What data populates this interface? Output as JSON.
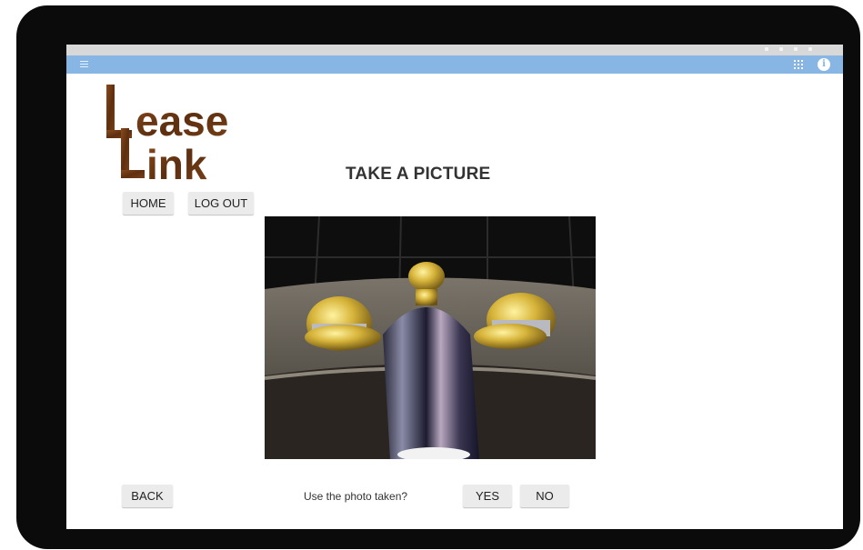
{
  "colors": {
    "app_bar": "#87b6e4",
    "device_frame": "#0b0b0b",
    "logo_brown": "#6e3a16"
  },
  "app_bar": {
    "menu_icon": "hamburger-icon",
    "grid_icon": "apps-grid-icon",
    "info_icon": "info-icon"
  },
  "logo": {
    "line1": "ease",
    "line2": "ink"
  },
  "nav": {
    "home_label": "HOME",
    "logout_label": "LOG OUT"
  },
  "page_title": "TAKE A PICTURE",
  "photo": {
    "subject": "sink-faucet-photo"
  },
  "footer": {
    "back_label": "BACK",
    "prompt": "Use the photo taken?",
    "yes_label": "YES",
    "no_label": "NO"
  }
}
